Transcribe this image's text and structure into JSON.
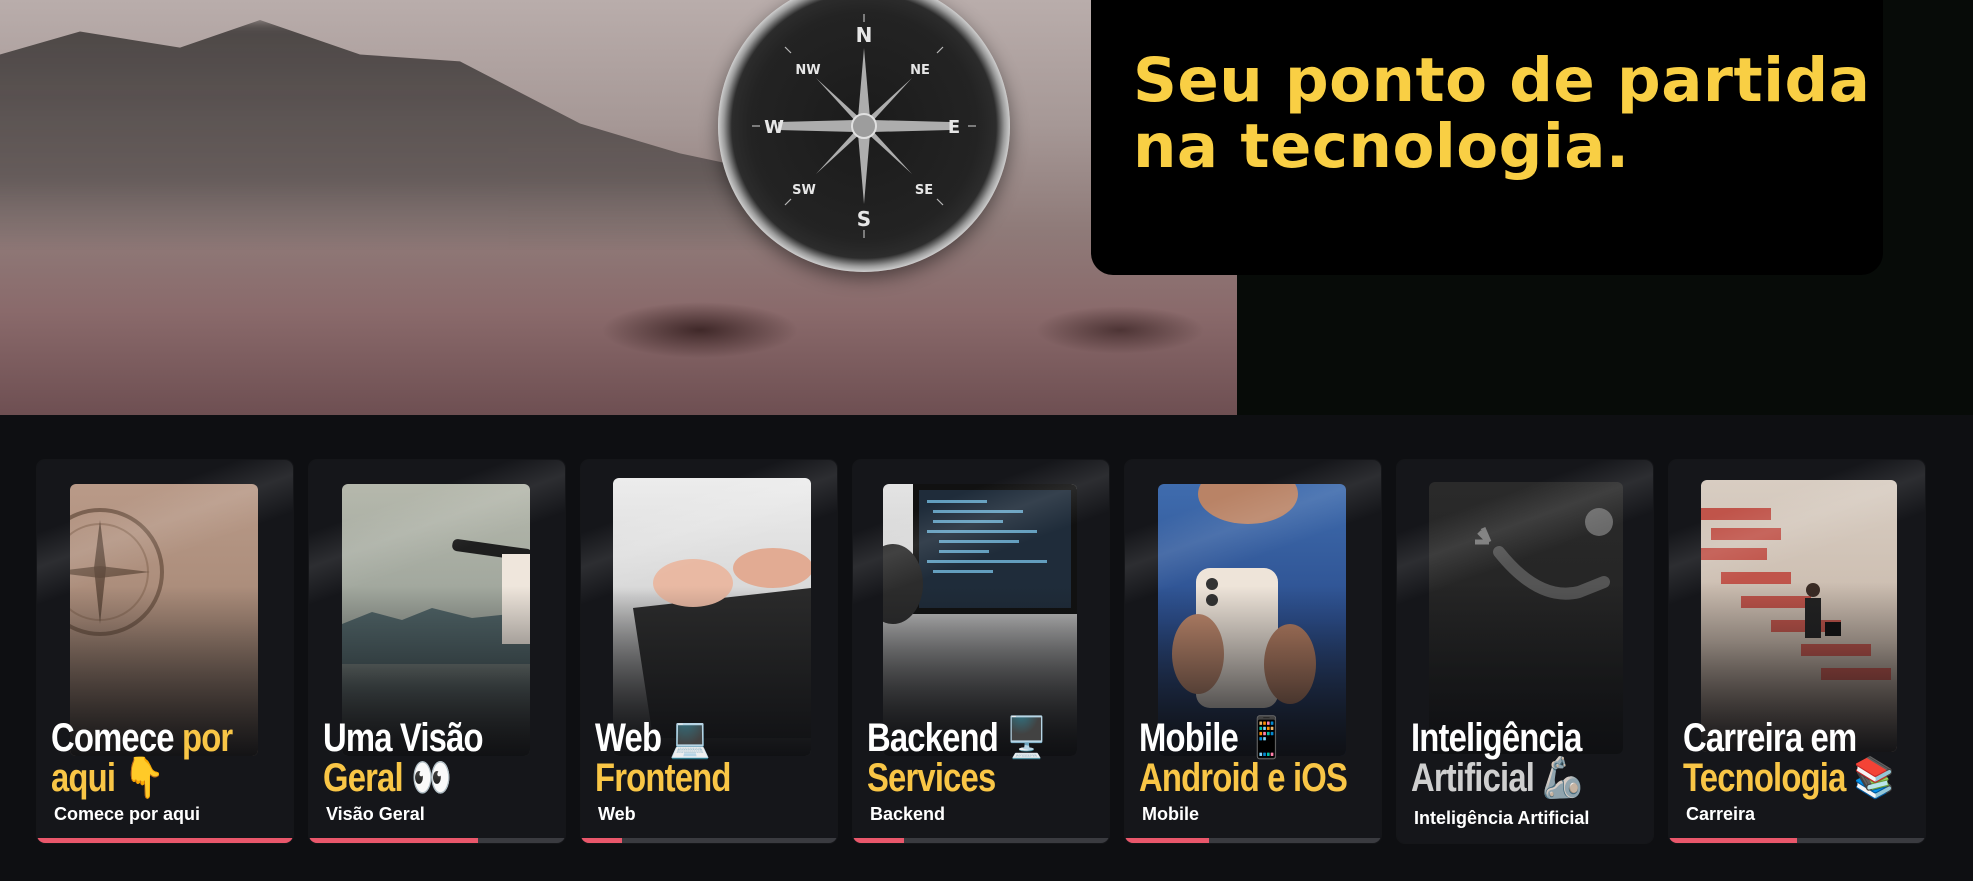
{
  "hero": {
    "title": "Seu ponto de partida na tecnologia.",
    "accent_color": "#f9cf44",
    "compass_letters": {
      "n": "N",
      "s": "S",
      "e": "E",
      "w": "W",
      "ne": "NE",
      "nw": "NW",
      "se": "SE",
      "sw": "SW"
    }
  },
  "cards": [
    {
      "title_white": "Comece ",
      "title_highlight": "por",
      "title_line2": "aqui",
      "title_emoji": "👇",
      "subtitle": "Comece por aqui",
      "progress": 1.0,
      "image": "compass"
    },
    {
      "title_white": "Uma Visão",
      "title_highlight": "Geral",
      "title_emoji": "👀",
      "subtitle": "Visão Geral",
      "progress": 0.66,
      "image": "telescope"
    },
    {
      "title_white": "Web",
      "title_emoji": "💻",
      "title_highlight": "Frontend",
      "subtitle": "Web",
      "progress": 0.16,
      "image": "laptop"
    },
    {
      "title_white": "Backend",
      "title_emoji": "🖥️",
      "title_highlight": "Services",
      "subtitle": "Backend",
      "progress": 0.2,
      "image": "monitor-code"
    },
    {
      "title_white": "Mobile",
      "title_emoji": "📱",
      "title_highlight": "Android e iOS",
      "subtitle": "Mobile",
      "progress": 0.33,
      "image": "smartphone"
    },
    {
      "title_white": "Inteligência",
      "title_gray": "Artificial",
      "title_emoji": "🦾",
      "subtitle": "Inteligência Artificial",
      "progress": 0.0,
      "image": "robot-arm"
    },
    {
      "title_white": "Carreira em",
      "title_highlight": "Tecnologia",
      "title_emoji": "📚",
      "subtitle": "Carreira",
      "progress": 0.5,
      "image": "stairs"
    }
  ],
  "colors": {
    "progress_fill": "#e9576b",
    "progress_track": "#3a3b40",
    "highlight": "#f9c646"
  }
}
